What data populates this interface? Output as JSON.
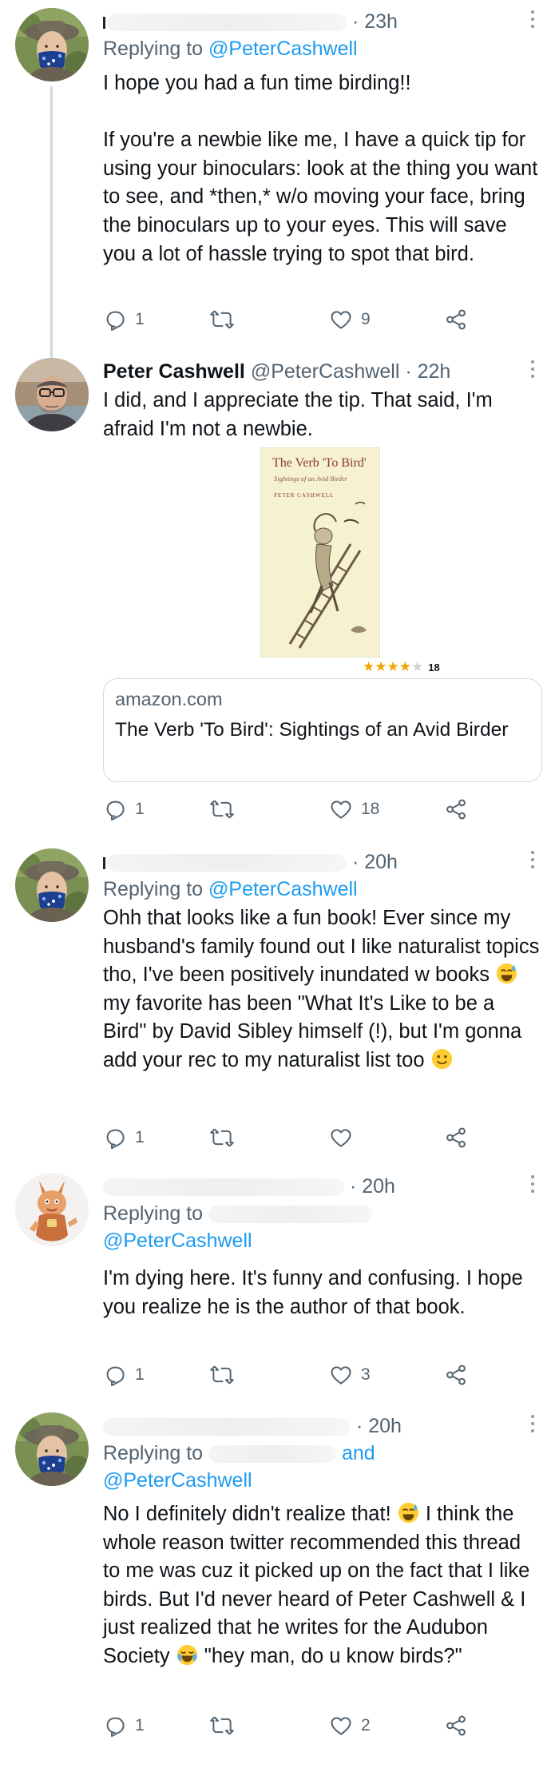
{
  "tweets": [
    {
      "id": "t1",
      "author_name": "",
      "timestamp": "23h",
      "replying_prefix": "Replying to",
      "replying_to": "@PeterCashwell",
      "text": "I hope you had a fun time birding!!\n\nIf you're a newbie like me, I have a quick tip for using your binoculars: look at the thing you want to see, and *then,* w/o moving your face, bring the binoculars up to your eyes. This will save you a lot of hassle trying to spot that bird.",
      "replies": "1",
      "retweets": "",
      "likes": "9"
    },
    {
      "id": "t2",
      "author_name": "Peter Cashwell",
      "author_handle": "@PeterCashwell",
      "timestamp": "22h",
      "text": "I did, and I appreciate the tip. That said, I'm afraid I'm not a newbie.",
      "book": {
        "cover_title": "The Verb 'To Bird'",
        "cover_subtitle": "Sightings of an Avid Birder",
        "cover_author": "PETER CASHWELL",
        "rating_count": "18"
      },
      "card": {
        "domain": "amazon.com",
        "title": "The Verb 'To Bird': Sightings of an Avid Birder"
      },
      "replies": "1",
      "retweets": "",
      "likes": "18"
    },
    {
      "id": "t3",
      "author_name": "",
      "timestamp": "20h",
      "replying_prefix": "Replying to",
      "replying_to": "@PeterCashwell",
      "text_a": "Ohh that looks like a fun book! Ever since my husband's family found out I like naturalist topics tho, I've been positively inundated w books ",
      "text_b": " my favorite has been \"What It's Like to be a Bird\" by David Sibley himself (!), but I'm gonna add your rec to my naturalist list too ",
      "replies": "1",
      "retweets": "",
      "likes": ""
    },
    {
      "id": "t4",
      "author_name": "",
      "timestamp": "20h",
      "replying_prefix": "Replying to",
      "replying_to_line2": "@PeterCashwell",
      "text": "I'm dying here. It's funny and confusing. I hope you realize he is the author of that book.",
      "replies": "1",
      "retweets": "",
      "likes": "3"
    },
    {
      "id": "t5",
      "author_name": "",
      "timestamp": "20h",
      "replying_prefix": "Replying to",
      "replying_and": "and",
      "replying_to_line2": "@PeterCashwell",
      "text_a": "No I definitely didn't realize that! ",
      "text_b": " I think the whole reason twitter recommended this thread to me was cuz it picked up on the fact that I like birds. But I'd never heard of Peter Cashwell & I just realized that he writes for the Audubon Society ",
      "text_c": " \"hey man, do u know birds?\"",
      "replies": "1",
      "retweets": "",
      "likes": "2"
    }
  ],
  "icons": [
    "reply-icon",
    "retweet-icon",
    "like-icon",
    "share-icon",
    "more-icon"
  ],
  "colors": {
    "link": "#1d9bf0",
    "secondary_text": "#536471",
    "thread_line": "#cfd9de",
    "star": "#f0a400"
  }
}
